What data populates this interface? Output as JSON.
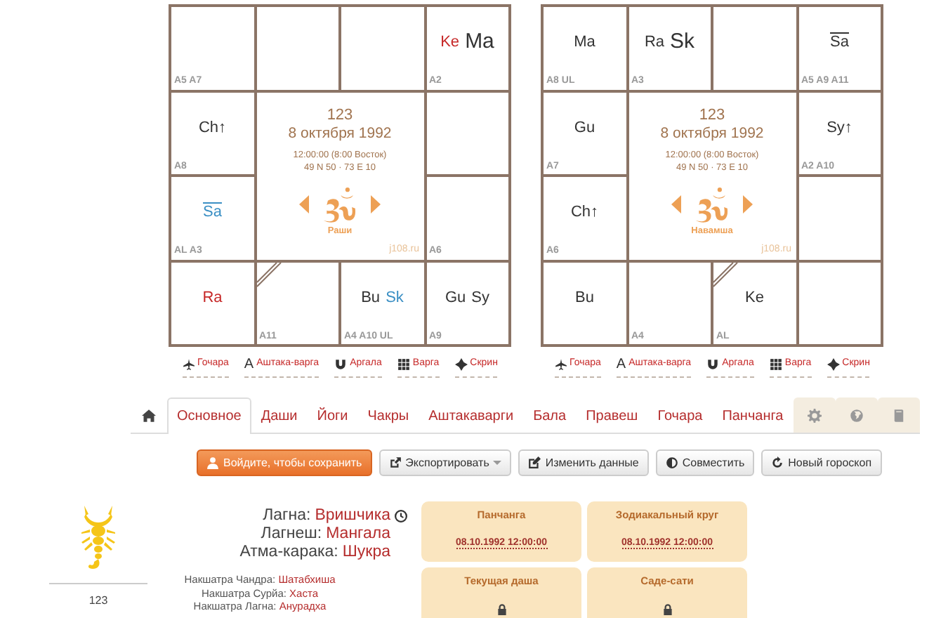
{
  "charts": [
    {
      "title": "123",
      "date": "8 октября 1992",
      "time": "12:00:00 (8:00 Восток)",
      "coords": "49 N 50 · 73 E 10",
      "name": "Раши",
      "site": "j108.ru",
      "cells": [
        {
          "label": "A5 A7",
          "lagna": false
        },
        {
          "lagna": false
        },
        {
          "lagna": false
        },
        {
          "label": "A2",
          "lagna": false,
          "planets": [
            {
              "text": "Ke",
              "color": "#c62828",
              "large": false,
              "retro": false
            },
            {
              "text": "Ma",
              "color": "#333333",
              "large": true,
              "retro": false
            }
          ]
        },
        {
          "label": "A8",
          "lagna": false,
          "planets": [
            {
              "text": "Ch↑",
              "color": "#333333",
              "large": false,
              "retro": false
            }
          ]
        },
        {
          "lagna": false
        },
        {
          "label": "AL A3",
          "lagna": false,
          "planets": [
            {
              "text": "Sa",
              "color": "#3a8fc4",
              "large": false,
              "retro": true
            }
          ]
        },
        {
          "label": "A6",
          "lagna": false
        },
        {
          "lagna": false,
          "planets": [
            {
              "text": "Ra",
              "color": "#c62828",
              "large": false,
              "retro": false
            }
          ]
        },
        {
          "label": "A11",
          "lagna": true
        },
        {
          "label": "A4 A10 UL",
          "lagna": false,
          "planets": [
            {
              "text": "Bu",
              "color": "#333333",
              "large": false,
              "retro": false
            },
            {
              "text": "Sk",
              "color": "#3a8fc4",
              "large": false,
              "retro": false
            }
          ]
        },
        {
          "label": "A9",
          "lagna": false,
          "planets": [
            {
              "text": "Gu",
              "color": "#333333",
              "large": false,
              "retro": false
            },
            {
              "text": "Sy",
              "color": "#333333",
              "large": false,
              "retro": false
            }
          ]
        }
      ]
    },
    {
      "title": "123",
      "date": "8 октября 1992",
      "time": "12:00:00 (8:00 Восток)",
      "coords": "49 N 50 · 73 E 10",
      "name": "Навамша",
      "site": "j108.ru",
      "cells": [
        {
          "label": "A8 UL",
          "lagna": false,
          "planets": [
            {
              "text": "Ma",
              "color": "#333333",
              "large": false,
              "retro": false
            }
          ]
        },
        {
          "label": "A3",
          "lagna": false,
          "planets": [
            {
              "text": "Ra",
              "color": "#333333",
              "large": false,
              "retro": false
            },
            {
              "text": "Sk",
              "color": "#333333",
              "large": true,
              "retro": false
            }
          ]
        },
        {
          "lagna": false
        },
        {
          "label": "A5 A9 A11",
          "lagna": false,
          "planets": [
            {
              "text": "Sa",
              "color": "#333333",
              "large": false,
              "retro": true
            }
          ]
        },
        {
          "label": "A7",
          "lagna": false,
          "planets": [
            {
              "text": "Gu",
              "color": "#333333",
              "large": false,
              "retro": false
            }
          ]
        },
        {
          "label": "A2 A10",
          "lagna": false,
          "planets": [
            {
              "text": "Sy↑",
              "color": "#333333",
              "large": false,
              "retro": false
            }
          ]
        },
        {
          "label": "A6",
          "lagna": false,
          "planets": [
            {
              "text": "Ch↑",
              "color": "#333333",
              "large": false,
              "retro": false
            }
          ]
        },
        {
          "lagna": false
        },
        {
          "lagna": false,
          "planets": [
            {
              "text": "Bu",
              "color": "#333333",
              "large": false,
              "retro": false
            }
          ]
        },
        {
          "label": "A4",
          "lagna": false
        },
        {
          "label": "AL",
          "lagna": true,
          "planets": [
            {
              "text": "Ke",
              "color": "#333333",
              "large": false,
              "retro": false
            }
          ]
        },
        {
          "lagna": false
        }
      ]
    }
  ],
  "chart_links": [
    {
      "kind": "plane",
      "label": "Гочара"
    },
    {
      "kind": "letter",
      "glyph": "A",
      "label": "Аштака-варга"
    },
    {
      "kind": "magnet",
      "label": "Аргала"
    },
    {
      "kind": "grid",
      "label": "Варга"
    },
    {
      "kind": "compass",
      "label": "Скрин"
    }
  ],
  "chart_links_2": [
    {
      "kind": "plane",
      "label": "Гочара"
    },
    {
      "kind": "letter",
      "glyph": "A",
      "label": "Аштака-варга"
    },
    {
      "kind": "magnet",
      "label": "Аргала"
    },
    {
      "kind": "grid",
      "label": "Варга"
    },
    {
      "kind": "compass",
      "label": "Скрин"
    }
  ],
  "tabs": [
    {
      "kind": "home",
      "selected": false
    },
    {
      "kind": "text",
      "label": "Основное",
      "selected": true
    },
    {
      "kind": "text",
      "label": "Даши",
      "selected": false
    },
    {
      "kind": "text",
      "label": "Йоги",
      "selected": false
    },
    {
      "kind": "text",
      "label": "Чакры",
      "selected": false
    },
    {
      "kind": "text",
      "label": "Аштакаварги",
      "selected": false
    },
    {
      "kind": "text",
      "label": "Бала",
      "selected": false
    },
    {
      "kind": "text",
      "label": "Правеш",
      "selected": false
    },
    {
      "kind": "text",
      "label": "Гочара",
      "selected": false
    },
    {
      "kind": "text",
      "label": "Панчанга",
      "selected": false
    },
    {
      "kind": "gear",
      "selected": false
    },
    {
      "kind": "globe",
      "selected": false
    },
    {
      "kind": "book",
      "selected": false
    }
  ],
  "buttons": [
    {
      "kind": "primary",
      "label": "Войдите, чтобы сохранить",
      "dropdown": false
    },
    {
      "kind": "default",
      "label": "Экспортировать",
      "dropdown": true
    },
    {
      "kind": "default",
      "label": "Изменить данные",
      "dropdown": false
    },
    {
      "kind": "default",
      "label": "Совместить",
      "dropdown": false
    },
    {
      "kind": "default",
      "label": "Новый гороскоп",
      "dropdown": false
    }
  ],
  "profile": {
    "name": "123"
  },
  "main_facts": [
    {
      "label": "Лагна:",
      "value": "Вришчика",
      "clock": true
    },
    {
      "label": "Лагнеш:",
      "value": "Мангала",
      "clock": false
    },
    {
      "label": "Атма-карака:",
      "value": "Шукра",
      "clock": false
    }
  ],
  "nakshatras": [
    {
      "label": "Накшатра Чандра:",
      "value": "Шатабхиша"
    },
    {
      "label": "Накшатра Сурйа:",
      "value": "Хаста"
    },
    {
      "label": "Накшатра Лагна:",
      "value": "Анурадха"
    }
  ],
  "cards": [
    {
      "title": "Панчанга",
      "date": "08.10.1992 12:00:00",
      "locked": false
    },
    {
      "title": "Зодиакальный круг",
      "date": "08.10.1992 12:00:00",
      "locked": false
    },
    {
      "title": "Текущая даша",
      "locked": true
    },
    {
      "title": "Саде-сати",
      "locked": true
    }
  ]
}
